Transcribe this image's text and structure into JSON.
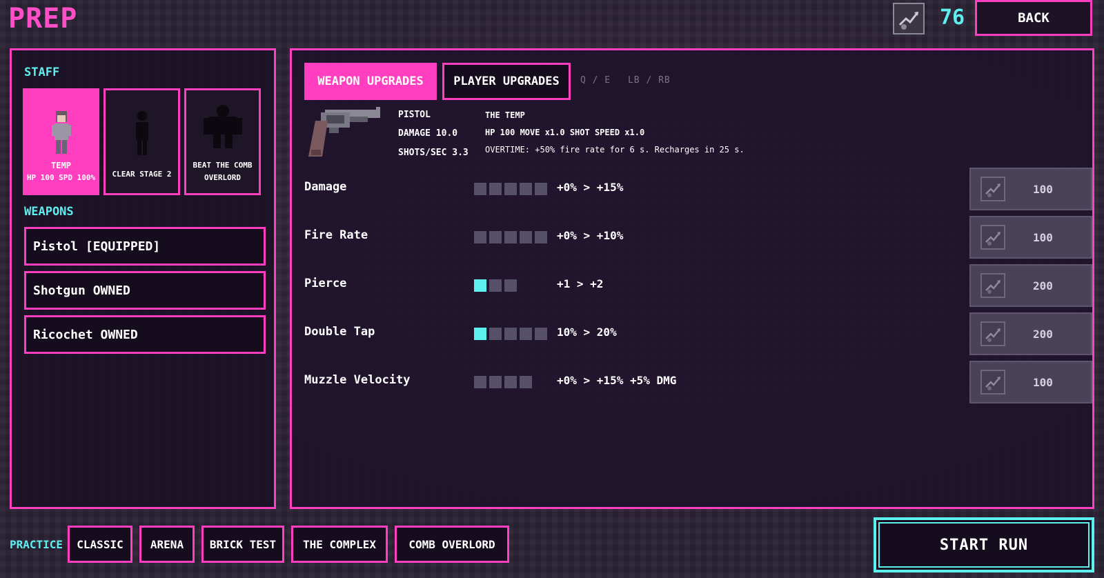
{
  "header": {
    "title": "PREP",
    "currency_icon": "upgrade-token-icon",
    "currency": "76",
    "back_label": "BACK"
  },
  "left": {
    "staff_label": "STAFF",
    "staff": [
      {
        "name": "TEMP",
        "sub": "HP 100  SPD 100%",
        "selected": true
      },
      {
        "name": "CLEAR STAGE 2",
        "sub": "",
        "locked": true
      },
      {
        "name": "BEAT THE COMB",
        "sub": "OVERLORD",
        "locked": true
      }
    ],
    "weapons_label": "WEAPONS",
    "weapons": [
      {
        "label": "Pistol  [EQUIPPED]"
      },
      {
        "label": "Shotgun  OWNED"
      },
      {
        "label": "Ricochet  OWNED"
      }
    ]
  },
  "right": {
    "tabs": [
      {
        "label": "WEAPON UPGRADES",
        "active": true
      },
      {
        "label": "PLAYER UPGRADES",
        "active": false
      }
    ],
    "hint_keys": "Q / E",
    "hint_pad": "LB / RB",
    "weapon": {
      "icon": "revolver-icon",
      "name": "PISTOL",
      "damage": "DAMAGE 10.0",
      "shots": "SHOTS/SEC 3.3"
    },
    "staff_info": {
      "title": "THE TEMP",
      "stats": "HP 100   MOVE x1.0   SHOT SPEED x1.0",
      "overtime": "OVERTIME: +50% fire rate for 6 s. Recharges in 25 s."
    },
    "upgrades": [
      {
        "name": "Damage",
        "level": 0,
        "max": 5,
        "value": "+0% > +15%",
        "cost": "100"
      },
      {
        "name": "Fire Rate",
        "level": 0,
        "max": 5,
        "value": "+0% > +10%",
        "cost": "100"
      },
      {
        "name": "Pierce",
        "level": 1,
        "max": 3,
        "value": "+1 > +2",
        "cost": "200"
      },
      {
        "name": "Double Tap",
        "level": 1,
        "max": 5,
        "value": "10% > 20%",
        "cost": "200"
      },
      {
        "name": "Muzzle Velocity",
        "level": 0,
        "max": 4,
        "value": "+0% > +15% +5% DMG",
        "cost": "100"
      }
    ]
  },
  "footer": {
    "practice_label": "PRACTICE",
    "modes": [
      "CLASSIC",
      "ARENA",
      "BRICK TEST",
      "THE COMPLEX",
      "COMB OVERLORD"
    ],
    "start_label": "START RUN"
  },
  "colors": {
    "accent_pink": "#ff3fbf",
    "accent_cyan": "#5ef0ee",
    "panel_bg": "#1e1526"
  }
}
